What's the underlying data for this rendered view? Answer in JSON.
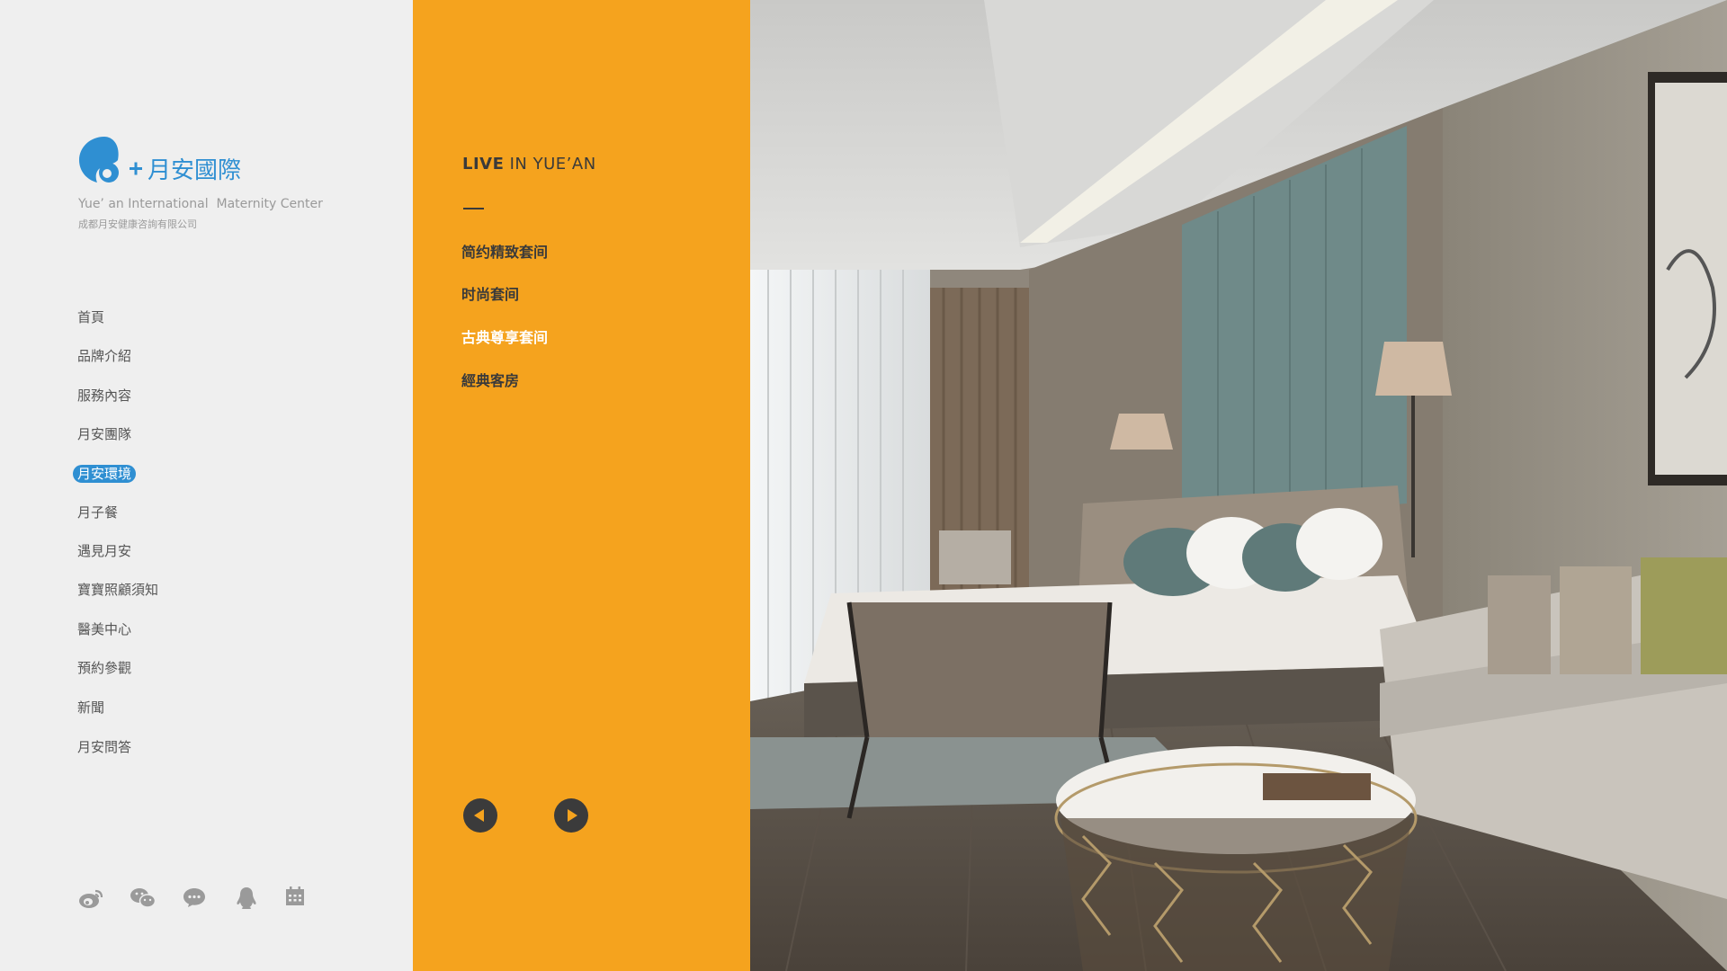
{
  "brand": {
    "logo_cn": "月安國際",
    "name_en": "Yue’ an International  Maternity Center",
    "company_cn": "成都月安健康咨詢有限公司",
    "accent": "#2f8fd2"
  },
  "nav": {
    "items": [
      {
        "label": "首頁"
      },
      {
        "label": "品牌介紹"
      },
      {
        "label": "服務內容"
      },
      {
        "label": "月安團隊"
      },
      {
        "label": "月安環境",
        "active": true
      },
      {
        "label": "月子餐"
      },
      {
        "label": "遇見月安"
      },
      {
        "label": "寶寶照顧須知"
      },
      {
        "label": "醫美中心"
      },
      {
        "label": "預約參觀"
      },
      {
        "label": "新聞"
      },
      {
        "label": "月安問答"
      }
    ]
  },
  "social": [
    "weibo-icon",
    "wechat-icon",
    "message-icon",
    "qq-icon",
    "calendar-icon"
  ],
  "panel": {
    "title_bold": "LIVE",
    "title_rest": " IN YUE’AN",
    "color": "#f5a31e",
    "rooms": [
      {
        "label": "简约精致套间"
      },
      {
        "label": "时尚套间"
      },
      {
        "label": "古典尊享套间",
        "active": true
      },
      {
        "label": "經典客房"
      }
    ]
  }
}
